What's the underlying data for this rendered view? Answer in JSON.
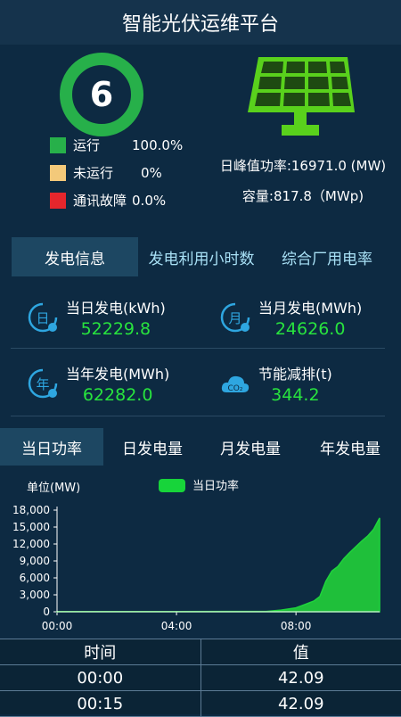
{
  "app": {
    "title": "智能光伏运维平台"
  },
  "summary": {
    "station_count": "6",
    "legend": [
      {
        "label": "运行",
        "value": "100.0%",
        "color": "#27b04a"
      },
      {
        "label": "未运行",
        "value": "0%",
        "color": "#f3c97a"
      },
      {
        "label": "通讯故障",
        "value": "0.0%",
        "color": "#e5262c"
      }
    ],
    "peak_power": "日峰值功率:16971.0 (MW)",
    "capacity": "容量:817.8（MWp)"
  },
  "tabs_top": [
    {
      "label": "发电信息",
      "active": true
    },
    {
      "label": "发电利用小时数",
      "active": false
    },
    {
      "label": "综合厂用电率",
      "active": false
    }
  ],
  "stats": [
    {
      "label": "当日发电(kWh)",
      "value": "52229.8",
      "icon_char": "日"
    },
    {
      "label": "当月发电(MWh)",
      "value": "24626.0",
      "icon_char": "月"
    },
    {
      "label": "当年发电(MWh)",
      "value": "62282.0",
      "icon_char": "年"
    },
    {
      "label": "节能减排(t)",
      "value": "344.2",
      "icon_char": "CO₂"
    }
  ],
  "tabs_bottom": [
    {
      "label": "当日功率",
      "active": true
    },
    {
      "label": "日发电量",
      "active": false
    },
    {
      "label": "月发电量",
      "active": false
    },
    {
      "label": "年发电量",
      "active": false
    }
  ],
  "chart_data": {
    "type": "area",
    "ylabel": "单位(MW)",
    "series": [
      {
        "name": "当日功率",
        "color": "#1fbf3a",
        "x": [
          0,
          4,
          7,
          7.5,
          8,
          8.3,
          8.6,
          8.8,
          9,
          9.2,
          9.4,
          9.6,
          9.8,
          10,
          10.2,
          10.4,
          10.6,
          10.8
        ],
        "y": [
          42.09,
          42,
          60,
          300,
          700,
          1300,
          1900,
          2700,
          5400,
          7200,
          8000,
          9400,
          10500,
          11500,
          12500,
          13400,
          14600,
          16600
        ]
      }
    ],
    "xlim": [
      0,
      10.8
    ],
    "ylim": [
      0,
      18000
    ],
    "yticks": [
      "0",
      "3,000",
      "6,000",
      "9,000",
      "12,000",
      "15,000",
      "18,000"
    ],
    "xticks": [
      {
        "x": 0,
        "label": "00:00"
      },
      {
        "x": 4,
        "label": "04:00"
      },
      {
        "x": 8,
        "label": "08:00"
      }
    ]
  },
  "table": {
    "headers": [
      "时间",
      "值"
    ],
    "rows": [
      [
        "00:00",
        "42.09"
      ],
      [
        "00:15",
        "42.09"
      ]
    ]
  }
}
